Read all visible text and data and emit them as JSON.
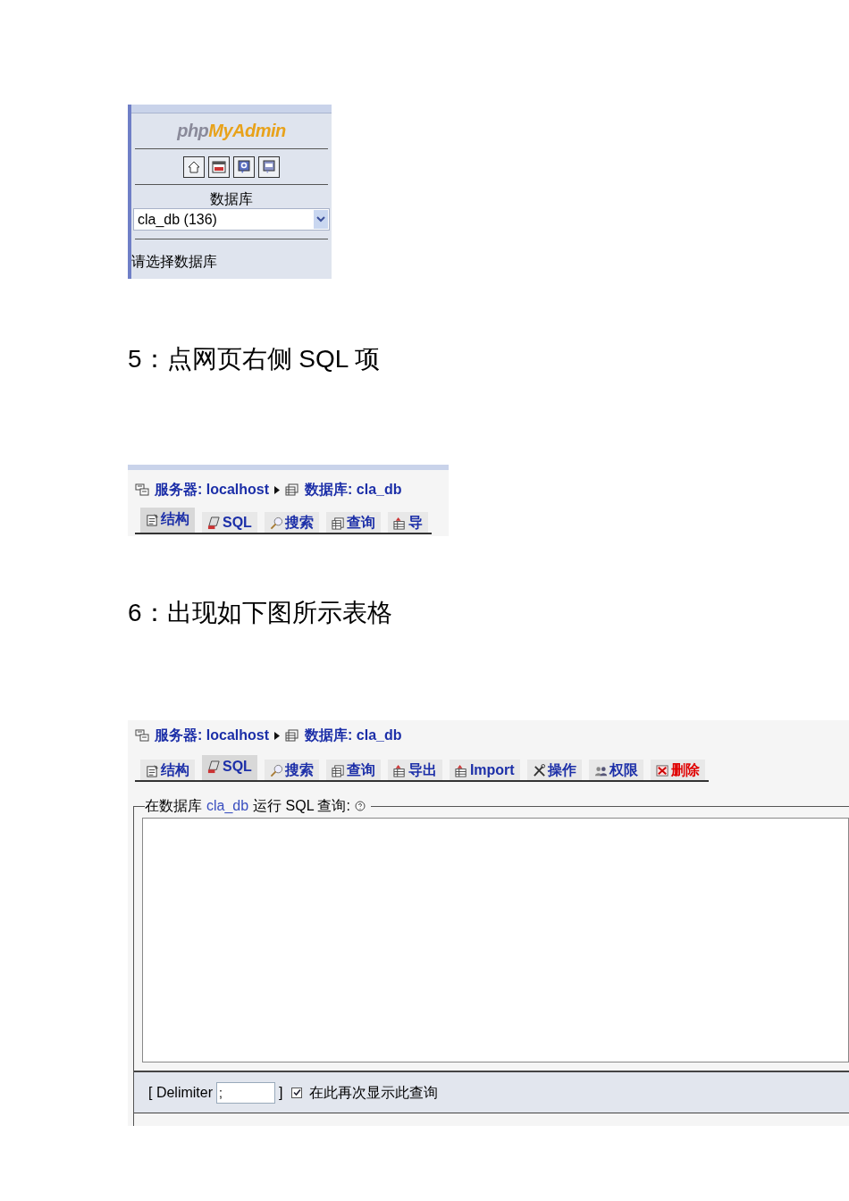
{
  "panel_1": {
    "logo": {
      "part_1": "php",
      "part_2": "MyAdmin"
    },
    "database_label": "数据库",
    "database_select": {
      "value": "cla_db (136)"
    },
    "hint": "请选择数据库"
  },
  "step_5": "5：点网页右侧 SQL 项",
  "panel_2": {
    "breadcrumb": [
      {
        "kind": "server",
        "label": "服务器:",
        "value": "localhost"
      },
      {
        "kind": "database",
        "label": "数据库:",
        "value": "cla_db"
      }
    ],
    "tabs": [
      {
        "kind": "structure",
        "label": "结构",
        "selected": true
      },
      {
        "kind": "sql",
        "label": "SQL",
        "selected": false
      },
      {
        "kind": "search",
        "label": "搜索",
        "selected": false
      },
      {
        "kind": "query",
        "label": "查询",
        "selected": false
      },
      {
        "kind": "export",
        "label": "导",
        "selected": false
      }
    ]
  },
  "step_6": "6：出现如下图所示表格",
  "panel_3": {
    "breadcrumb": [
      {
        "kind": "server",
        "label": "服务器:",
        "value": "localhost"
      },
      {
        "kind": "database",
        "label": "数据库:",
        "value": "cla_db"
      }
    ],
    "tabs": [
      {
        "kind": "structure",
        "label": "结构",
        "selected": false
      },
      {
        "kind": "sql",
        "label": "SQL",
        "selected": true
      },
      {
        "kind": "search",
        "label": "搜索",
        "selected": false
      },
      {
        "kind": "query",
        "label": "查询",
        "selected": false
      },
      {
        "kind": "export",
        "label": "导出",
        "selected": false
      },
      {
        "kind": "import",
        "label": "Import",
        "selected": false
      },
      {
        "kind": "operations",
        "label": "操作",
        "selected": false
      },
      {
        "kind": "privileges",
        "label": "权限",
        "selected": false
      },
      {
        "kind": "drop",
        "label": "删除",
        "selected": false
      }
    ],
    "query_legend": {
      "prefix": "在数据库",
      "database": "cla_db",
      "suffix": "运行 SQL 查询:"
    },
    "delimiter": {
      "open": "[ Delimiter",
      "value": ";",
      "close": "]"
    },
    "show_again": {
      "label": "在此再次显示此查询",
      "checked": true
    }
  }
}
